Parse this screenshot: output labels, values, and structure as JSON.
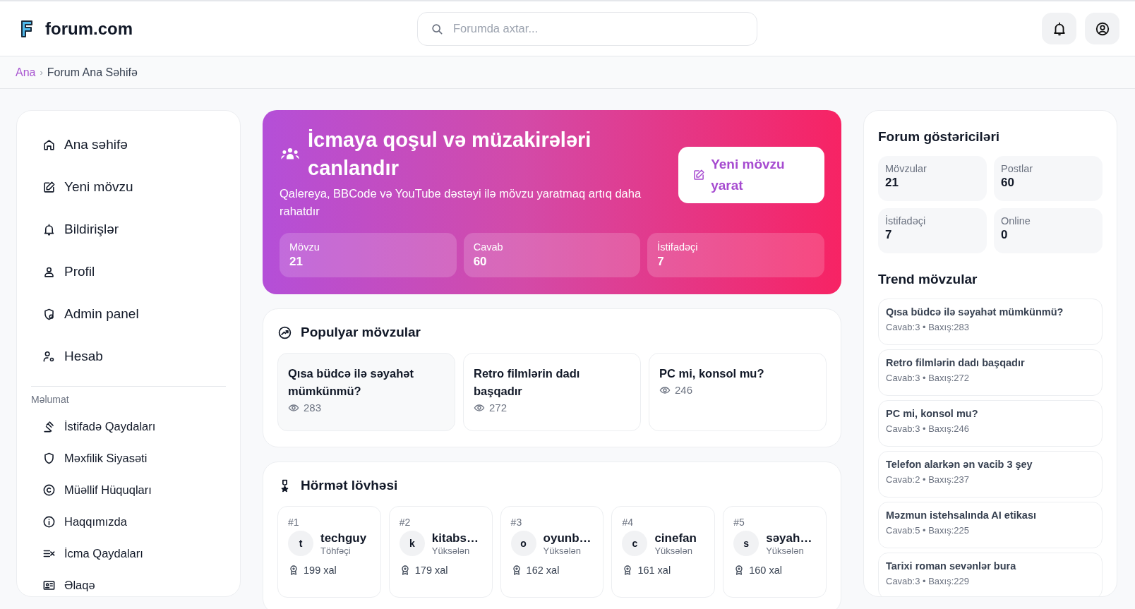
{
  "header": {
    "site_name": "forum.com",
    "search": {
      "placeholder": "Forumda axtar..."
    }
  },
  "breadcrumb": [
    {
      "label": "Ana",
      "link": true
    },
    {
      "label": "›",
      "link": false
    },
    {
      "label": "Forum Ana Səhifə",
      "link": false
    }
  ],
  "sidebar": {
    "items": [
      {
        "label": "Ana səhifə"
      },
      {
        "label": "Yeni mövzu"
      },
      {
        "label": "Bildirişlər"
      },
      {
        "label": "Profil"
      },
      {
        "label": "Admin panel"
      },
      {
        "label": "Hesab"
      }
    ],
    "section_title": "Məlumat",
    "info_items": [
      {
        "label": "İstifadə Qaydaları"
      },
      {
        "label": "Məxfilik Siyasəti"
      },
      {
        "label": "Müəllif Hüquqları"
      },
      {
        "label": "Haqqımızda"
      },
      {
        "label": "İcma Qaydaları"
      },
      {
        "label": "Əlaqə"
      }
    ]
  },
  "hero": {
    "title": "İcmaya qoşul və müzakirələri canlandır",
    "subtitle": "Qalereya, BBCode və YouTube dəstəyi ilə mövzu yaratmaq artıq daha rahatdır",
    "button": "Yeni mövzu yarat",
    "stats": [
      {
        "label": "Mövzu",
        "value": "21"
      },
      {
        "label": "Cavab",
        "value": "60"
      },
      {
        "label": "İstifadəçi",
        "value": "7"
      }
    ]
  },
  "popular": {
    "title": "Populyar mövzular",
    "topics": [
      {
        "title": "Qısa büdcə ilə səyahət mümkünmü?",
        "views": "283"
      },
      {
        "title": "Retro filmlərin dadı başqadır",
        "views": "272"
      },
      {
        "title": "PC mi, konsol mu?",
        "views": "246"
      }
    ]
  },
  "leaderboard": {
    "title": "Hörmət lövhəsi",
    "users": [
      {
        "rank": "#1",
        "initial": "t",
        "name": "techguy",
        "role": "Töhfəçi",
        "points": "199 xal"
      },
      {
        "rank": "#2",
        "initial": "k",
        "name": "kitabs…",
        "role": "Yüksələn",
        "points": "179 xal"
      },
      {
        "rank": "#3",
        "initial": "o",
        "name": "oyunb…",
        "role": "Yüksələn",
        "points": "162 xal"
      },
      {
        "rank": "#4",
        "initial": "c",
        "name": "cinefan",
        "role": "Yüksələn",
        "points": "161 xal"
      },
      {
        "rank": "#5",
        "initial": "s",
        "name": "səyah…",
        "role": "Yüksələn",
        "points": "160 xal"
      }
    ]
  },
  "stats_panel": {
    "title": "Forum göstəriciləri",
    "stats": [
      {
        "label": "Mövzular",
        "value": "21"
      },
      {
        "label": "Postlar",
        "value": "60"
      },
      {
        "label": "İstifadəçi",
        "value": "7"
      },
      {
        "label": "Online",
        "value": "0"
      }
    ]
  },
  "trending": {
    "title": "Trend mövzular",
    "topics": [
      {
        "title": "Qısa büdcə ilə səyahət mümkünmü?",
        "meta": "Cavab:3 • Baxış:283"
      },
      {
        "title": "Retro filmlərin dadı başqadır",
        "meta": "Cavab:3 • Baxış:272"
      },
      {
        "title": "PC mi, konsol mu?",
        "meta": "Cavab:3 • Baxış:246"
      },
      {
        "title": "Telefon alarkən ən vacib 3 şey",
        "meta": "Cavab:2 • Baxış:237"
      },
      {
        "title": "Məzmun istehsalında AI etikası",
        "meta": "Cavab:5 • Baxış:225"
      },
      {
        "title": "Tarixi roman sevənlər bura",
        "meta": "Cavab:3 • Baxış:229"
      }
    ]
  }
}
